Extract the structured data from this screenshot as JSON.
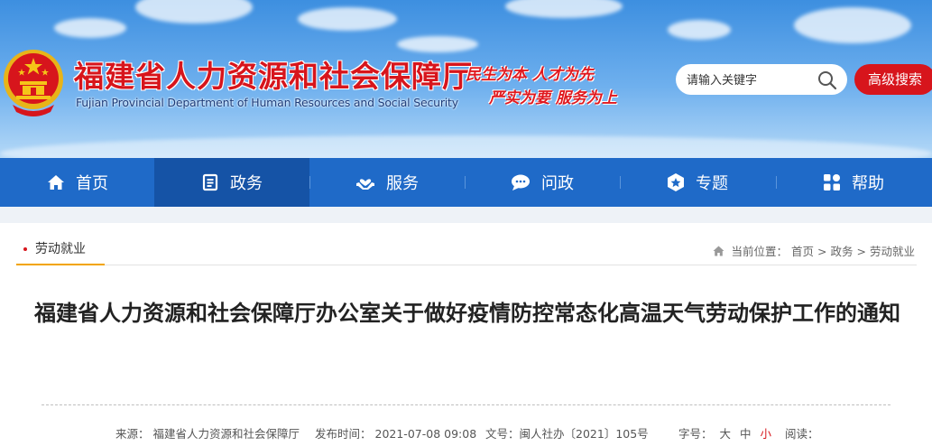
{
  "header": {
    "title_cn": "福建省人力资源和社会保障厅",
    "title_en": "Fujian Provincial Department of Human Resources and Social Security",
    "slogan_line1": "民生为本 人才为先",
    "slogan_line2": "严实为要 服务为上",
    "search_placeholder": "请输入关键字",
    "advanced_search": "高级搜索"
  },
  "nav": {
    "items": [
      {
        "label": "首页",
        "icon": "home-icon"
      },
      {
        "label": "政务",
        "icon": "document-list-icon"
      },
      {
        "label": "服务",
        "icon": "heart-hand-icon"
      },
      {
        "label": "问政",
        "icon": "chat-bubble-icon"
      },
      {
        "label": "专题",
        "icon": "star-badge-icon"
      },
      {
        "label": "帮助",
        "icon": "grid-apps-icon"
      }
    ],
    "active_index": 1
  },
  "breadcrumb": {
    "section": "劳动就业",
    "prefix": "当前位置：",
    "items": [
      "首页",
      "政务",
      "劳动就业"
    ],
    "separator": ">"
  },
  "article": {
    "title": "福建省人力资源和社会保障厅办公室关于做好疫情防控常态化高温天气劳动保护工作的通知"
  },
  "meta": {
    "source_label": "来源：",
    "source": "福建省人力资源和社会保障厅",
    "date_label": "发布时间：",
    "date": "2021-07-08 09:08",
    "doc_label": "文号：",
    "doc_no": "闽人社办〔2021〕105号",
    "font_label": "字号：",
    "font_large": "大",
    "font_medium": "中",
    "font_small": "小",
    "views_label": "阅读："
  },
  "colors": {
    "brand_red": "#d7151c",
    "nav_blue": "#1f6ac8",
    "nav_active": "#1553a6",
    "tab_underline": "#f2a400"
  }
}
